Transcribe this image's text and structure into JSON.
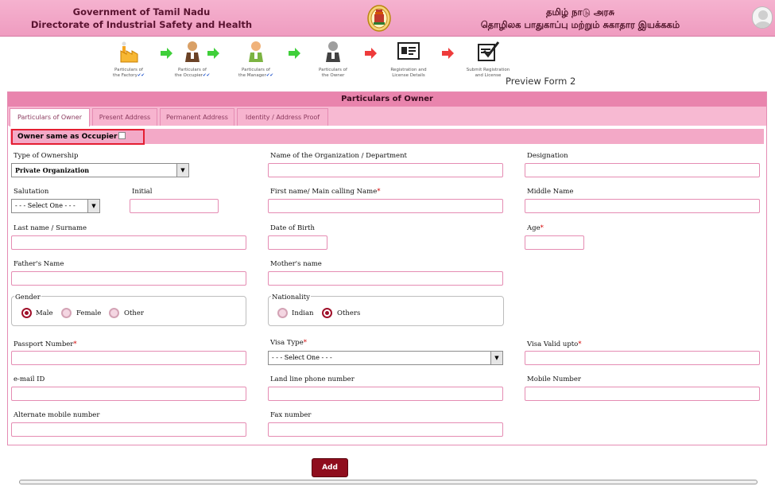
{
  "header": {
    "left_line1": "Government of Tamil Nadu",
    "left_line2": "Directorate of Industrial Safety and Health",
    "right_line1": "தமிழ் நாடு அரசு",
    "right_line2": "தொழிலக பாதுகாப்பு மற்றும் சுகாதார இயக்ககம்",
    "emblem_icon": "tamil-nadu-emblem",
    "avatar_icon": "user-avatar-icon"
  },
  "steps": [
    {
      "line1": "Particulars of",
      "line2": "the Factory",
      "checks": "✔✔",
      "icon": "factory-icon"
    },
    {
      "line1": "Particulars of",
      "line2": "the Occupier",
      "checks": "✔✔",
      "icon": "occupier-icon"
    },
    {
      "line1": "Particulars of",
      "line2": "the Manager",
      "checks": "✔✔",
      "icon": "manager-icon"
    },
    {
      "line1": "Particulars of",
      "line2": "the Owner",
      "checks": "",
      "icon": "owner-icon"
    },
    {
      "line1": "Registration and",
      "line2": "License Details",
      "checks": "",
      "icon": "registration-card-icon"
    },
    {
      "line1": "Submit Registration",
      "line2": "and License",
      "checks": "",
      "icon": "submit-check-icon"
    }
  ],
  "preview_label": "Preview Form 2",
  "panel_title": "Particulars of Owner",
  "tabs": [
    "Particulars of Owner",
    "Present Address",
    "Permanent Address",
    "Identity / Address Proof"
  ],
  "owner_same_label": "Owner same as Occupier",
  "owner_same_checked": false,
  "form": {
    "type_of_ownership": {
      "label": "Type of Ownership",
      "value": "Private Organization"
    },
    "org_name": {
      "label": "Name of the Organization / Department"
    },
    "designation": {
      "label": "Designation"
    },
    "salutation": {
      "label": "Salutation",
      "value": "- - - Select One - - -"
    },
    "initial": {
      "label": "Initial"
    },
    "first_name": {
      "label": "First name/ Main calling Name",
      "required": "*"
    },
    "middle_name": {
      "label": "Middle Name"
    },
    "last_name": {
      "label": "Last name / Surname"
    },
    "dob": {
      "label": "Date of Birth"
    },
    "age": {
      "label": "Age",
      "required": "*"
    },
    "father_name": {
      "label": "Father's Name"
    },
    "mother_name": {
      "label": "Mother's name"
    },
    "gender": {
      "label": "Gender",
      "options": [
        "Male",
        "Female",
        "Other"
      ],
      "selected": "Male"
    },
    "nationality": {
      "label": "Nationality",
      "options": [
        "Indian",
        "Others"
      ],
      "selected": "Others"
    },
    "passport": {
      "label": "Passport Number",
      "required": "*"
    },
    "visa_type": {
      "label": "Visa Type",
      "required": "*",
      "value": "- - - Select One - - -"
    },
    "visa_valid": {
      "label": "Visa Valid upto",
      "required": "*"
    },
    "email": {
      "label": "e-mail ID"
    },
    "landline": {
      "label": "Land line phone number"
    },
    "mobile": {
      "label": "Mobile Number"
    },
    "alt_mobile": {
      "label": "Alternate mobile number"
    },
    "fax": {
      "label": "Fax number"
    }
  },
  "add_button": "Add",
  "colors": {
    "accent": "#e984ad",
    "header": "#f5b2cf",
    "button": "#8f0d1d",
    "highlight": "#e41f32"
  }
}
